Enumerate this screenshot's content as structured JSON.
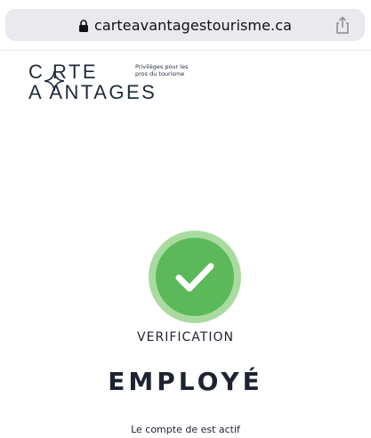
{
  "browser": {
    "url": "carteavantagestourisme.ca",
    "lock_icon": "lock-icon",
    "share_icon": "share-icon"
  },
  "logo": {
    "line1": "C  RTE",
    "line2": "A  ANTAGES",
    "tagline": "Privilèges pour les pros du tourisme"
  },
  "verification": {
    "label": "VERIFICATION",
    "title": "EMPLOYÉ",
    "status": "Le compte de est actif"
  },
  "colors": {
    "badge_outer": "#a9dba0",
    "badge_inner": "#5bb95a",
    "text": "#1d2330"
  }
}
